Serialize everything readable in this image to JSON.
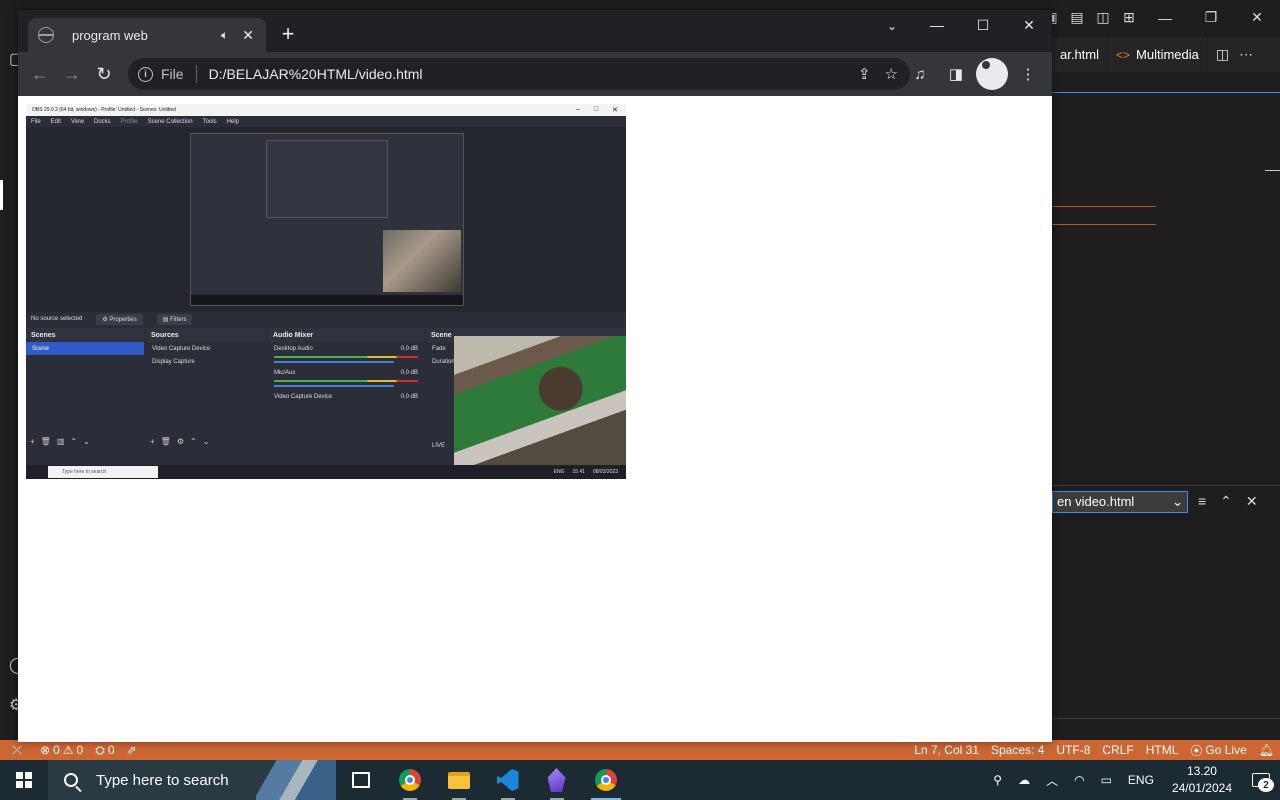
{
  "browser": {
    "tab_title": "program web",
    "omnibox_scheme": "File",
    "url": "D:/BELAJAR%20HTML/video.html"
  },
  "vscode": {
    "tab1": "ar.html",
    "tab2": "Multimedia",
    "panel_select": "en video.html",
    "status": {
      "errors": "0",
      "warnings": "0",
      "ports": "0",
      "position": "Ln 7, Col 31",
      "spaces": "Spaces: 4",
      "encoding": "UTF-8",
      "eol": "CRLF",
      "language": "HTML",
      "golive": "Go Live"
    }
  },
  "video": {
    "obs_title": "OBS 29.0.2 (64 bit, windows) - Profile: Untitled - Scenes: Untitled",
    "menu": [
      "File",
      "Edit",
      "View",
      "Docks",
      "Profile",
      "Scene Collection",
      "Tools",
      "Help"
    ],
    "no_source": "No source selected",
    "properties": "Properties",
    "filters": "Filters",
    "scenes_header": "Scenes",
    "scene_item": "Scene",
    "sources_header": "Sources",
    "sources": [
      "Video Capture Device",
      "Display Capture"
    ],
    "mixer_header": "Audio Mixer",
    "mixer": [
      {
        "name": "Desktop Audio",
        "db": "0.0 dB"
      },
      {
        "name": "Mic/Aux",
        "db": "0.0 dB"
      },
      {
        "name": "Video Capture Device",
        "db": "0.0 dB"
      }
    ],
    "transitions_header": "Scene",
    "fade": "Fade",
    "duration": "Duration",
    "live": "LIVE",
    "taskbar_search": "Type here to search",
    "lang": "ENG",
    "time": "15.41",
    "date": "08/03/2023"
  },
  "taskbar": {
    "search_placeholder": "Type here to search",
    "lang": "ENG",
    "time": "13.20",
    "date": "24/01/2024",
    "notifications": "2"
  }
}
